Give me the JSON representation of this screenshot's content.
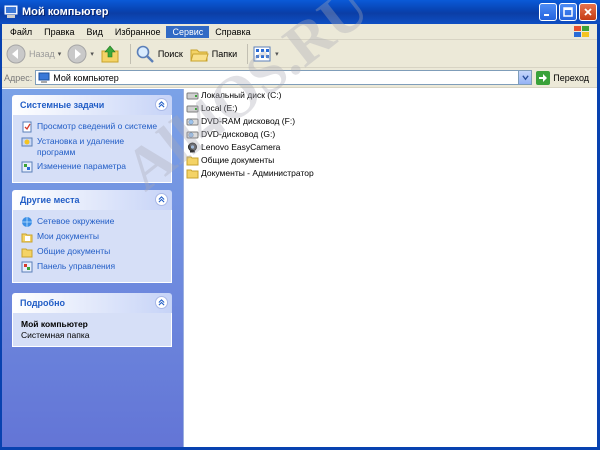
{
  "window": {
    "title": "Мой компьютер"
  },
  "menu": [
    "Файл",
    "Правка",
    "Вид",
    "Избранное",
    "Сервис",
    "Справка"
  ],
  "toolbar": {
    "back_label": "Назад",
    "search_label": "Поиск",
    "folders_label": "Папки"
  },
  "address": {
    "label": "Адрес:",
    "value": "Мой компьютер",
    "go_label": "Переход"
  },
  "panels": {
    "system": {
      "title": "Системные задачи",
      "items": [
        "Просмотр сведений о системе",
        "Установка и удаление программ",
        "Изменение параметра"
      ]
    },
    "places": {
      "title": "Другие места",
      "items": [
        "Сетевое окружение",
        "Мои документы",
        "Общие документы",
        "Панель управления"
      ]
    },
    "details": {
      "title": "Подробно",
      "name": "Мой компьютер",
      "type": "Системная папка"
    }
  },
  "files": [
    {
      "label": "Локальный диск (C:)",
      "icon": "hard-drive-icon"
    },
    {
      "label": "Local (E:)",
      "icon": "hard-drive-icon"
    },
    {
      "label": "DVD-RAM дисковод (F:)",
      "icon": "dvd-drive-icon"
    },
    {
      "label": "DVD-дисковод (G:)",
      "icon": "dvd-drive-icon"
    },
    {
      "label": "Lenovo EasyCamera",
      "icon": "webcam-icon"
    },
    {
      "label": "Общие документы",
      "icon": "folder-icon"
    },
    {
      "label": "Документы - Администратор",
      "icon": "folder-icon"
    }
  ],
  "watermark": "All4OS.RU",
  "colors": {
    "titlebar": "#0842b0",
    "menu_active": "#316ac5",
    "taskpane_top": "#7ba2e7",
    "taskpane_bottom": "#6375d6",
    "link": "#215dc6"
  }
}
